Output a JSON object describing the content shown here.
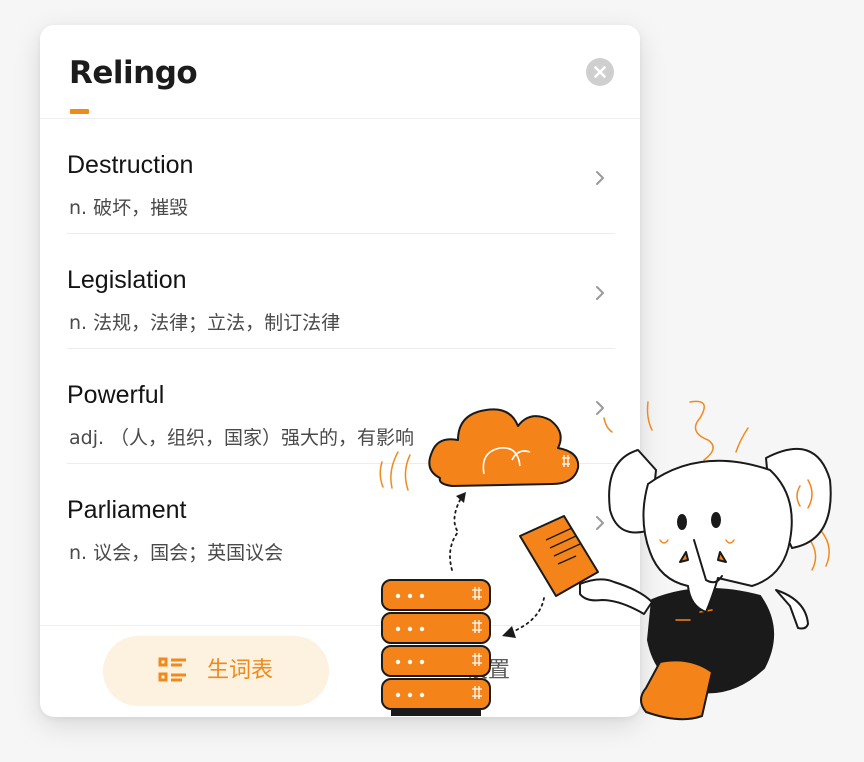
{
  "brand": {
    "logo_text": "Relingo",
    "accent_color": "#f08a1c"
  },
  "header": {
    "close_icon": "close-icon"
  },
  "words": [
    {
      "term": "Destruction",
      "definition": "n. 破坏，摧毁"
    },
    {
      "term": "Legislation",
      "definition": "n. 法规，法律；立法，制订法律"
    },
    {
      "term": "Powerful",
      "definition": "adj. （人，组织，国家）强大的，有影响"
    },
    {
      "term": "Parliament",
      "definition": "n. 议会，国会；英国议会"
    }
  ],
  "footer": {
    "vocab_label": "生词表",
    "vocab_icon": "list-icon",
    "settings_label": "设置"
  }
}
